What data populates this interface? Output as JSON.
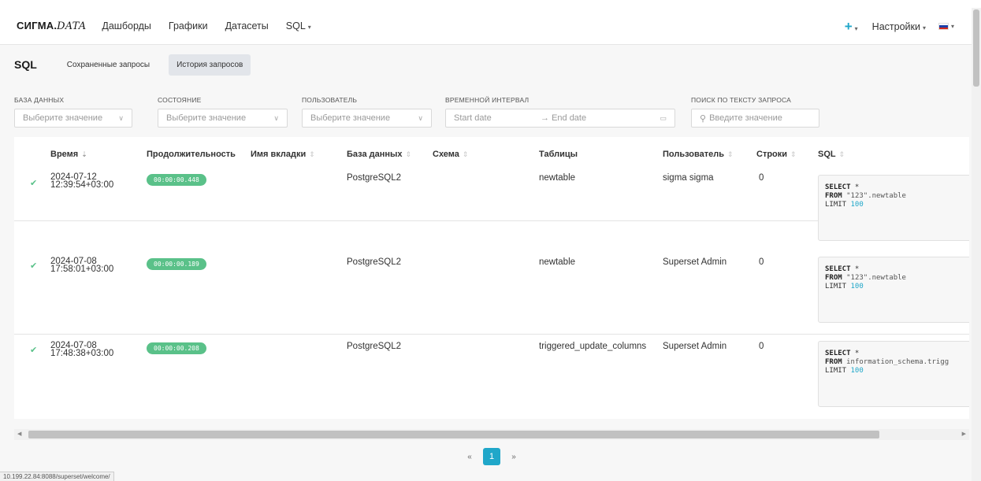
{
  "navbar": {
    "brand_main": "СИГМА.",
    "brand_italic": "DATA",
    "items": [
      "Дашборды",
      "Графики",
      "Датасеты",
      "SQL"
    ],
    "plus_label": "+",
    "settings_label": "Настройки"
  },
  "subheader": {
    "title": "SQL",
    "tabs": [
      "Сохраненные запросы",
      "История запросов"
    ]
  },
  "filters": {
    "database": {
      "label": "База данных",
      "placeholder": "Выберите значение"
    },
    "status": {
      "label": "Состояние",
      "placeholder": "Выберите значение"
    },
    "user": {
      "label": "Пользователь",
      "placeholder": "Выберите значение"
    },
    "interval": {
      "label": "Временной интервал",
      "start": "Start date",
      "end": "End date"
    },
    "search": {
      "label": "Поиск по тексту запроса",
      "placeholder": "Введите значение"
    }
  },
  "table": {
    "headers": [
      "Время",
      "Продолжительность",
      "Имя вкладки",
      "База данных",
      "Схема",
      "Таблицы",
      "Пользователь",
      "Строки",
      "SQL"
    ],
    "rows": [
      {
        "date": "2024-07-12",
        "time": "12:39:54+03:00",
        "duration": "00:00:00.448",
        "tab": "",
        "database": "PostgreSQL2",
        "schema": "",
        "tables": "newtable",
        "user": "sigma sigma",
        "rows": "0",
        "sql": {
          "l1": "SELECT",
          "l1b": " *",
          "l2": "FROM",
          "l2b": " \"123\".newtable",
          "l3": "LIMIT",
          "l3b": "100"
        }
      },
      {
        "date": "2024-07-08",
        "time": "17:58:01+03:00",
        "duration": "00:00:00.189",
        "tab": "",
        "database": "PostgreSQL2",
        "schema": "",
        "tables": "newtable",
        "user": "Superset Admin",
        "rows": "0",
        "sql": {
          "l1": "SELECT",
          "l1b": " *",
          "l2": "FROM",
          "l2b": " \"123\".newtable",
          "l3": "LIMIT",
          "l3b": "100"
        }
      },
      {
        "date": "2024-07-08",
        "time": "17:48:38+03:00",
        "duration": "00:00:00.208",
        "tab": "",
        "database": "PostgreSQL2",
        "schema": "",
        "tables": "triggered_update_columns",
        "user": "Superset Admin",
        "rows": "0",
        "sql": {
          "l1": "SELECT",
          "l1b": " *",
          "l2": "FROM",
          "l2b": " information_schema.trigg",
          "l3": "LIMIT",
          "l3b": "100"
        }
      }
    ]
  },
  "pagination": {
    "prev": "«",
    "current": "1",
    "next": "»"
  },
  "statusbar": {
    "url": "10.199.22.84:8088/superset/welcome/"
  },
  "colors": {
    "accent": "#20a7c9",
    "success": "#5ac189"
  }
}
